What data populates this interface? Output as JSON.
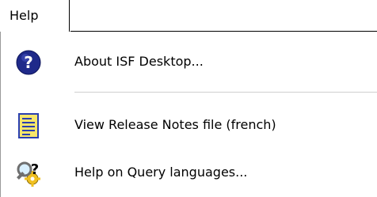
{
  "menubar": {
    "help_label": "Help"
  },
  "menu": {
    "items": [
      {
        "label": "About ISF Desktop...",
        "icon": "question-circle-icon"
      },
      {
        "label": "View Release Notes file (french)",
        "icon": "notes-document-icon"
      },
      {
        "label": "Help on Query languages...",
        "icon": "query-help-icon"
      }
    ]
  },
  "colors": {
    "question_blue": "#1f2a8a",
    "notes_blue": "#2a3fb0",
    "notes_yellow": "#f7e66a",
    "magnifier_grey": "#6f6f6f",
    "gear_yellow": "#f0c020"
  }
}
